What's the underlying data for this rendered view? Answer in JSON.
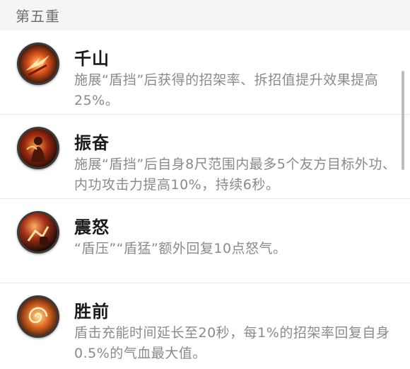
{
  "section": {
    "title": "第五重"
  },
  "skills": [
    {
      "icon": "flame-slash-icon",
      "name": "千山",
      "description": "施展“盾挡”后获得的招架率、拆招值提升效果提高25%。"
    },
    {
      "icon": "warrior-figure-icon",
      "name": "振奋",
      "description": "施展“盾挡”后自身8尺范围内最多5个友方目标外功、内功攻击力提高10%，持续6秒。"
    },
    {
      "icon": "shield-strike-icon",
      "name": "震怒",
      "description": "“盾压”“盾猛”额外回复10点怒气。"
    },
    {
      "icon": "swirl-icon",
      "name": "胜前",
      "description": "盾击充能时间延长至20秒，每1%的招架率回复自身0.5%的气血最大值。"
    }
  ],
  "colors": {
    "accent": "#c0391b",
    "icon_dark": "#2b1a12",
    "icon_glow": "#ff8a2a"
  }
}
